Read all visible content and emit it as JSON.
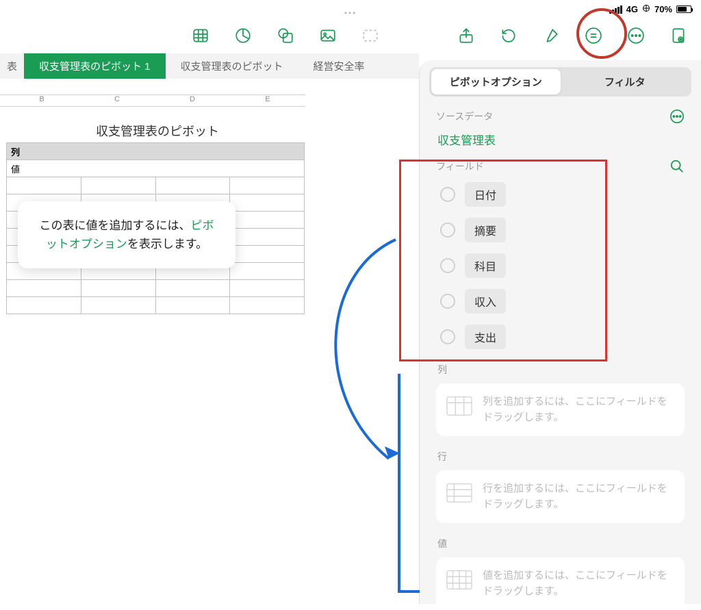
{
  "status": {
    "network": "4G",
    "battery_pct": "70%"
  },
  "tabs": [
    {
      "label": "表"
    },
    {
      "label": "収支管理表のピボット 1"
    },
    {
      "label": "収支管理表のピボット"
    },
    {
      "label": "経営安全率"
    }
  ],
  "columns": [
    "B",
    "C",
    "D",
    "E"
  ],
  "pivot": {
    "title": "収支管理表のピボット",
    "col_header": "列",
    "row_header": "値"
  },
  "hint": {
    "pre": "この表に値を追加するには、",
    "highlight": "ピボットオプション",
    "post": "を表示します。"
  },
  "panel": {
    "tabs": [
      "ピボットオプション",
      "フィルタ"
    ],
    "source_label": "ソースデータ",
    "source_value": "収支管理表",
    "fields_label": "フィールド",
    "fields": [
      "日付",
      "摘要",
      "科目",
      "収入",
      "支出"
    ],
    "zones": [
      {
        "label": "列",
        "hint": "列を追加するには、ここにフィールドをドラッグします。"
      },
      {
        "label": "行",
        "hint": "行を追加するには、ここにフィールドをドラッグします。"
      },
      {
        "label": "値",
        "hint": "値を追加するには、ここにフィールドをドラッグします。"
      }
    ]
  }
}
